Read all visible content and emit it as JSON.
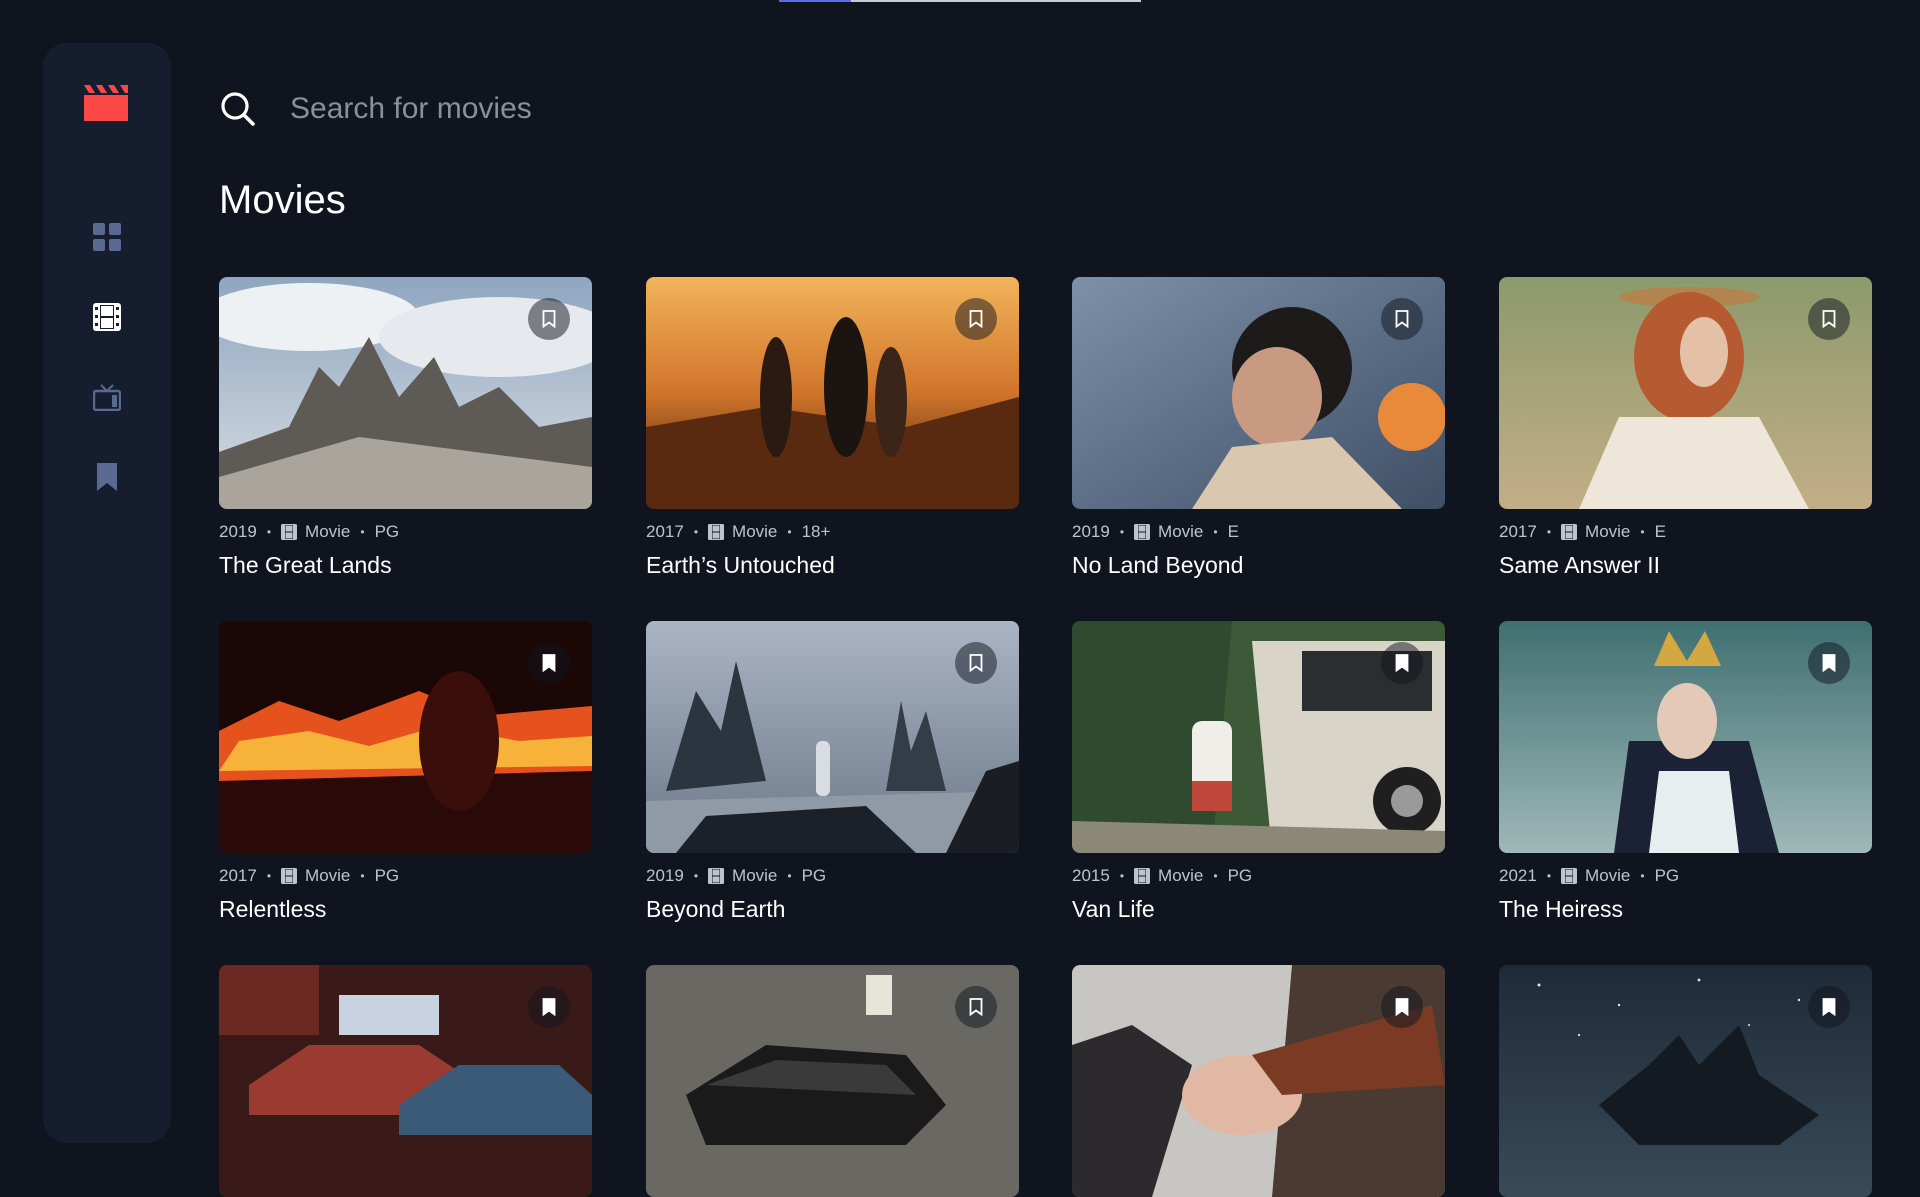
{
  "search": {
    "placeholder": "Search for movies"
  },
  "page_title": "Movies",
  "colors": {
    "accent": "#fc4747",
    "background": "#10141e",
    "sidebar": "#161d2f",
    "nav_icon": "#5a698f",
    "nav_active": "#ffffff"
  },
  "nav": [
    {
      "icon": "home-grid-icon",
      "active": false
    },
    {
      "icon": "movies-icon",
      "active": true
    },
    {
      "icon": "tv-series-icon",
      "active": false
    },
    {
      "icon": "bookmark-icon",
      "active": false
    }
  ],
  "movies": [
    {
      "year": "2019",
      "category": "Movie",
      "rating": "PG",
      "title": "The Great Lands",
      "bookmarked": false
    },
    {
      "year": "2017",
      "category": "Movie",
      "rating": "18+",
      "title": "Earth’s Untouched",
      "bookmarked": false
    },
    {
      "year": "2019",
      "category": "Movie",
      "rating": "E",
      "title": "No Land Beyond",
      "bookmarked": false
    },
    {
      "year": "2017",
      "category": "Movie",
      "rating": "E",
      "title": "Same Answer II",
      "bookmarked": false
    },
    {
      "year": "2017",
      "category": "Movie",
      "rating": "PG",
      "title": "Relentless",
      "bookmarked": true
    },
    {
      "year": "2019",
      "category": "Movie",
      "rating": "PG",
      "title": "Beyond Earth",
      "bookmarked": false
    },
    {
      "year": "2015",
      "category": "Movie",
      "rating": "PG",
      "title": "Van Life",
      "bookmarked": true
    },
    {
      "year": "2021",
      "category": "Movie",
      "rating": "PG",
      "title": "The Heiress",
      "bookmarked": true
    },
    {
      "bookmarked": true
    },
    {
      "bookmarked": false
    },
    {
      "bookmarked": true
    },
    {
      "bookmarked": true
    }
  ]
}
